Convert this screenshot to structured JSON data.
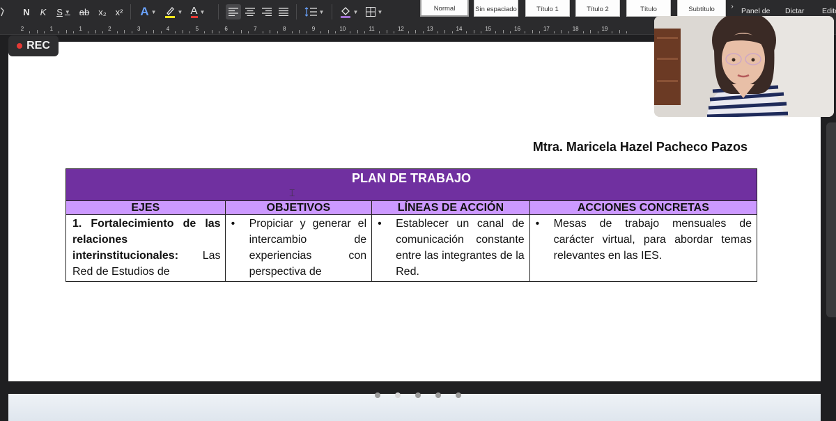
{
  "toolbar": {
    "bold": "N",
    "italic": "K",
    "underline": "S",
    "strikethrough": "ab",
    "subscript": "x₂",
    "superscript": "x²",
    "text_effects": "A",
    "font_color": "A"
  },
  "styles": [
    {
      "label": "Normal",
      "selected": true
    },
    {
      "label": "Sin espaciado",
      "selected": false
    },
    {
      "label": "Título 1",
      "selected": false
    },
    {
      "label": "Título 2",
      "selected": false
    },
    {
      "label": "Título",
      "selected": false
    },
    {
      "label": "Subtítulo",
      "selected": false
    }
  ],
  "ribbon_right": {
    "panel": "Panel de",
    "dictate": "Dictar",
    "editor": "Edito"
  },
  "ruler": [
    "2",
    "1",
    "1",
    "2",
    "3",
    "4",
    "5",
    "6",
    "7",
    "8",
    "9",
    "10",
    "11",
    "12",
    "13",
    "14",
    "15",
    "16",
    "17",
    "18",
    "19"
  ],
  "recording": {
    "label": "REC"
  },
  "document": {
    "author": "Mtra. Maricela Hazel Pacheco Pazos",
    "plan": {
      "title": "PLAN DE TRABAJO",
      "headers": [
        "EJES",
        "OBJETIVOS",
        "LÍNEAS DE ACCIÓN",
        "ACCIONES CONCRETAS"
      ],
      "ejes_bold": "1. Fortalecimiento de las relaciones interinstitucionales:",
      "ejes_rest": " Las Red de Estudios de",
      "objetivos": "Propiciar y generar el intercambio de experiencias con perspectiva de",
      "lineas": "Establecer un canal de comunicación constante entre las integrantes de la Red.",
      "acciones": "Mesas de trabajo mensuales de carácter virtual, para abordar temas relevantes en las IES."
    }
  },
  "colors": {
    "title_bg": "#7030a0",
    "header_bg": "#cc99ff"
  },
  "slides": {
    "count": 5,
    "active": 1
  }
}
